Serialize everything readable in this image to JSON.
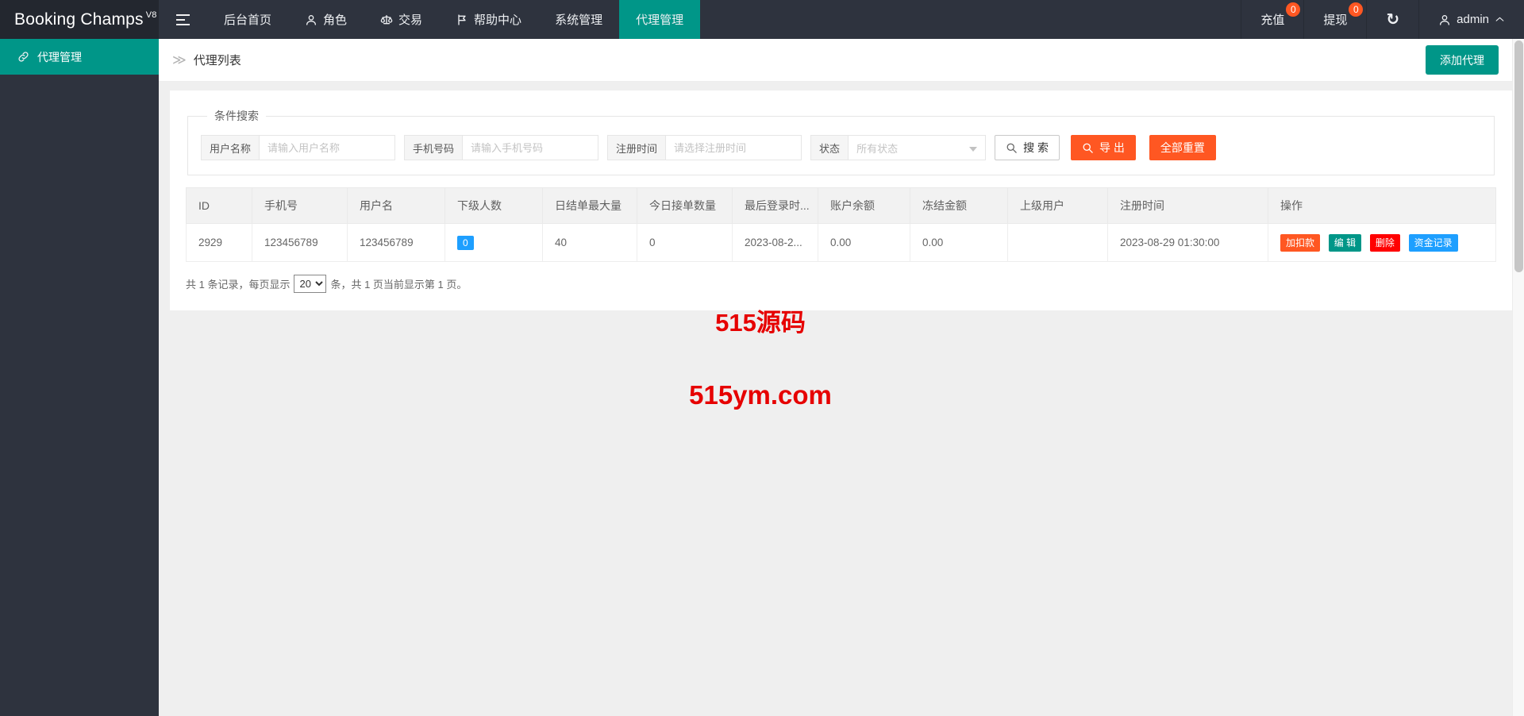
{
  "brand": {
    "name": "Booking Champs",
    "version": "V8"
  },
  "navbar": {
    "items": [
      {
        "label": "后台首页"
      },
      {
        "label": "角色",
        "icon": "person-icon"
      },
      {
        "label": "交易",
        "icon": "scales-icon"
      },
      {
        "label": "帮助中心",
        "icon": "flag-icon"
      },
      {
        "label": "系统管理"
      },
      {
        "label": "代理管理",
        "active": true
      }
    ],
    "right": {
      "recharge": {
        "label": "充值",
        "badge": "0"
      },
      "withdraw": {
        "label": "提现",
        "badge": "0"
      },
      "refresh_icon": "refresh-icon",
      "user": {
        "label": "admin",
        "icon": "person-icon"
      }
    }
  },
  "sidebar": {
    "items": [
      {
        "label": "代理管理",
        "icon": "link-icon",
        "active": true
      }
    ]
  },
  "breadcrumb": {
    "caret": "≫",
    "label": "代理列表"
  },
  "page": {
    "add_button": "添加代理"
  },
  "search": {
    "legend": "条件搜索",
    "fields": [
      {
        "label": "用户名称",
        "placeholder": "请输入用户名称"
      },
      {
        "label": "手机号码",
        "placeholder": "请输入手机号码"
      },
      {
        "label": "注册时间",
        "placeholder": "请选择注册时间"
      },
      {
        "label": "状态",
        "value": "所有状态",
        "type": "select"
      }
    ],
    "buttons": {
      "search": "搜 索",
      "export": "导 出",
      "reset": "全部重置"
    }
  },
  "table": {
    "headers": [
      "ID",
      "手机号",
      "用户名",
      "下级人数",
      "日结单最大量",
      "今日接单数量",
      "最后登录时...",
      "账户余额",
      "冻结金额",
      "上级用户",
      "注册时间",
      "操作"
    ],
    "rows": [
      {
        "id": "2929",
        "phone": "123456789",
        "username": "123456789",
        "subordinates": "0",
        "daily_max": "40",
        "today_orders": "0",
        "last_login": "2023-08-2...",
        "balance": "0.00",
        "frozen": "0.00",
        "parent": "",
        "reg_time": "2023-08-29 01:30:00"
      }
    ],
    "actions": [
      "加扣款",
      "编 辑",
      "删除",
      "资金记录"
    ]
  },
  "pagination": {
    "prefix": "共 1 条记录，每页显示",
    "per_page": "20",
    "suffix": "条，共 1 页当前显示第 1 页。"
  },
  "watermark": {
    "line1": "515源码",
    "line2": "515ym.com"
  },
  "colors": {
    "accent_teal": "#009688",
    "orange": "#ff5722",
    "blue": "#1e9fff",
    "red": "#ff0000",
    "navbar_bg": "#2e333e",
    "logo_bg": "#23272f",
    "watermark_red": "#e60000"
  }
}
